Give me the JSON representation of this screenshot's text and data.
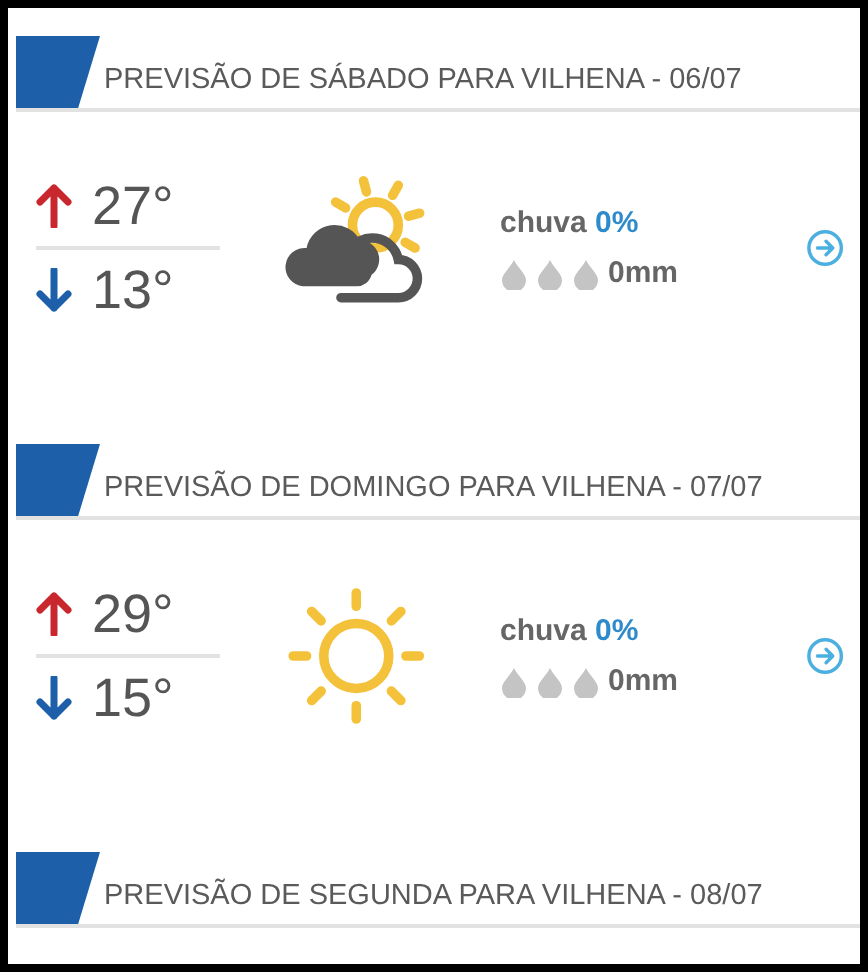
{
  "forecasts": [
    {
      "title": "PREVISÃO DE SÁBADO PARA VILHENA - 06/07",
      "high": "27°",
      "low": "13°",
      "kind": "partly-cloudy",
      "rain_label": "chuva",
      "rain_chance": "0%",
      "rain_amount": "0mm"
    },
    {
      "title": "PREVISÃO DE DOMINGO PARA VILHENA - 07/07",
      "high": "29°",
      "low": "15°",
      "kind": "sunny",
      "rain_label": "chuva",
      "rain_chance": "0%",
      "rain_amount": "0mm"
    },
    {
      "title": "PREVISÃO DE SEGUNDA PARA VILHENA - 08/07"
    }
  ]
}
